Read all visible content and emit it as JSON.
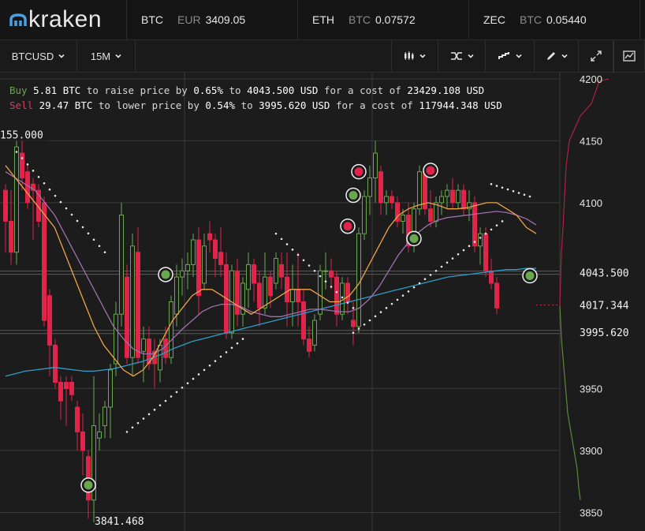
{
  "brand": {
    "name": "kraken"
  },
  "tickers": [
    {
      "symbol": "BTC",
      "quote": "EUR",
      "price": "3409.05"
    },
    {
      "symbol": "ETH",
      "quote": "BTC",
      "price": "0.07572"
    },
    {
      "symbol": "ZEC",
      "quote": "BTC",
      "price": "0.05440"
    }
  ],
  "toolbar": {
    "pair": "BTCUSD",
    "interval": "15M",
    "icons": [
      "candlestick-icon",
      "indicators-icon",
      "step-line-icon",
      "pencil-icon",
      "expand-icon",
      "screenshot-icon"
    ]
  },
  "trade_messages": {
    "buy": {
      "label": "Buy",
      "amount": "5.81 BTC",
      "action": "to raise price by",
      "pct": "0.65%",
      "to": "to",
      "target": "4043.500 USD",
      "cost_text": "for a cost of",
      "cost": "23429.108 USD"
    },
    "sell": {
      "label": "Sell",
      "amount": "29.47 BTC",
      "action": "to lower price by",
      "pct": "0.54%",
      "to": "to",
      "target": "3995.620 USD",
      "cost_text": "for a cost of",
      "cost": "117944.348 USD"
    }
  },
  "colors": {
    "up": "#6aa84f",
    "down": "#e0244a",
    "ema_fast": "#f0a44a",
    "ema_slow": "#a070b0",
    "ema_long": "#2e9ec8",
    "psar": "#e8e8e8",
    "depth_bid": "#5c8a3c",
    "depth_ask": "#b02040"
  },
  "chart_data": {
    "type": "candlestick",
    "pair": "BTCUSD",
    "interval": "15M",
    "ylim": [
      3835,
      4205
    ],
    "y_ticks": [
      4200,
      4150,
      4100,
      3950,
      3900,
      3850
    ],
    "price_labels": [
      {
        "label": "4043.500",
        "value": 4043.5,
        "style": "line"
      },
      {
        "label": "4017.344",
        "value": 4017.344,
        "style": "dashed"
      },
      {
        "label": "3995.620",
        "value": 3995.62,
        "style": "line"
      }
    ],
    "annotations": [
      {
        "label": "155.000",
        "value": 4155
      },
      {
        "label": "3841.468",
        "value": 3841.468
      }
    ],
    "candles": [
      [
        4110,
        4115,
        4060,
        4085
      ],
      [
        4085,
        4110,
        4050,
        4060
      ],
      [
        4060,
        4150,
        4050,
        4145
      ],
      [
        4140,
        4150,
        4110,
        4120
      ],
      [
        4125,
        4130,
        4095,
        4100
      ],
      [
        4115,
        4120,
        4070,
        4110
      ],
      [
        4110,
        4115,
        4080,
        4085
      ],
      [
        4100,
        4105,
        4000,
        4005
      ],
      [
        4025,
        4030,
        3960,
        3985
      ],
      [
        3985,
        3990,
        3950,
        3955
      ],
      [
        3955,
        3960,
        3925,
        3940
      ],
      [
        3955,
        3960,
        3920,
        3950
      ],
      [
        3955,
        3960,
        3940,
        3945
      ],
      [
        3935,
        3940,
        3900,
        3915
      ],
      [
        3915,
        3930,
        3880,
        3900
      ],
      [
        3895,
        3900,
        3845,
        3860
      ],
      [
        3860,
        3960,
        3842,
        3920
      ],
      [
        3910,
        3930,
        3900,
        3915
      ],
      [
        3920,
        3940,
        3910,
        3935
      ],
      [
        3935,
        3970,
        3910,
        3965
      ],
      [
        3970,
        4020,
        3960,
        4010
      ],
      [
        4010,
        4100,
        4000,
        4090
      ],
      [
        4040,
        4050,
        3970,
        3975
      ],
      [
        3975,
        4075,
        3960,
        4065
      ],
      [
        4060,
        4080,
        3970,
        3975
      ],
      [
        3980,
        4000,
        3955,
        3990
      ],
      [
        3990,
        4000,
        3965,
        3970
      ],
      [
        3980,
        3990,
        3950,
        3970
      ],
      [
        3965,
        3990,
        3955,
        3985
      ],
      [
        3990,
        4000,
        3970,
        3975
      ],
      [
        3975,
        4025,
        3970,
        4020
      ],
      [
        4010,
        4050,
        4000,
        4040
      ],
      [
        4040,
        4055,
        4025,
        4045
      ],
      [
        4045,
        4060,
        4030,
        4050
      ],
      [
        4050,
        4075,
        4040,
        4070
      ],
      [
        4070,
        4080,
        4010,
        4025
      ],
      [
        4035,
        4075,
        4030,
        4065
      ],
      [
        4075,
        4085,
        4060,
        4070
      ],
      [
        4070,
        4075,
        4040,
        4055
      ],
      [
        4060,
        4080,
        4040,
        4050
      ],
      [
        4050,
        4060,
        3990,
        3995
      ],
      [
        3995,
        4050,
        3990,
        4045
      ],
      [
        4045,
        4055,
        4000,
        4010
      ],
      [
        4010,
        4040,
        4000,
        4035
      ],
      [
        4030,
        4060,
        4015,
        4050
      ],
      [
        4050,
        4055,
        4020,
        4035
      ],
      [
        4035,
        4045,
        4000,
        4015
      ],
      [
        4015,
        4060,
        4010,
        4040
      ],
      [
        4040,
        4045,
        4015,
        4025
      ],
      [
        4035,
        4060,
        4030,
        4055
      ],
      [
        4050,
        4060,
        4030,
        4040
      ],
      [
        4040,
        4060,
        4000,
        4020
      ],
      [
        4020,
        4050,
        4000,
        4030
      ],
      [
        4030,
        4060,
        4000,
        4020
      ],
      [
        4020,
        4030,
        3985,
        3990
      ],
      [
        3990,
        4000,
        3975,
        3980
      ],
      [
        3985,
        4010,
        3980,
        4005
      ],
      [
        4010,
        4050,
        4005,
        4045
      ],
      [
        4045,
        4060,
        4030,
        4045
      ],
      [
        4045,
        4055,
        4030,
        4040
      ],
      [
        4040,
        4045,
        4000,
        4010
      ],
      [
        4010,
        4040,
        4005,
        4035
      ],
      [
        4035,
        4040,
        4010,
        4020
      ],
      [
        4005,
        4020,
        3985,
        4000
      ],
      [
        4000,
        4080,
        3995,
        4075
      ],
      [
        4075,
        4110,
        4070,
        4105
      ],
      [
        4105,
        4130,
        4090,
        4120
      ],
      [
        4120,
        4150,
        4100,
        4140
      ],
      [
        4125,
        4130,
        4090,
        4100
      ],
      [
        4100,
        4110,
        4090,
        4105
      ],
      [
        4105,
        4110,
        4095,
        4100
      ],
      [
        4100,
        4105,
        4080,
        4085
      ],
      [
        4085,
        4095,
        4075,
        4090
      ],
      [
        4090,
        4100,
        4060,
        4065
      ],
      [
        4070,
        4100,
        4060,
        4095
      ],
      [
        4095,
        4130,
        4090,
        4125
      ],
      [
        4125,
        4130,
        4090,
        4095
      ],
      [
        4095,
        4110,
        4080,
        4085
      ],
      [
        4085,
        4105,
        4080,
        4100
      ],
      [
        4100,
        4110,
        4090,
        4105
      ],
      [
        4105,
        4115,
        4095,
        4110
      ],
      [
        4110,
        4120,
        4095,
        4100
      ],
      [
        4100,
        4115,
        4095,
        4110
      ],
      [
        4110,
        4115,
        4090,
        4095
      ],
      [
        4095,
        4110,
        4085,
        4100
      ],
      [
        4100,
        4105,
        4060,
        4065
      ],
      [
        4065,
        4080,
        4050,
        4075
      ],
      [
        4075,
        4080,
        4040,
        4045
      ],
      [
        4045,
        4055,
        4030,
        4035
      ],
      [
        4035,
        4040,
        4010,
        4015
      ]
    ],
    "ema_fast": [
      4130,
      4120,
      4110,
      4100,
      4090,
      4080,
      4060,
      4040,
      4020,
      4000,
      3985,
      3975,
      3965,
      3960,
      3965,
      3975,
      3990,
      4005,
      4015,
      4025,
      4030,
      4030,
      4025,
      4020,
      4015,
      4010,
      4015,
      4020,
      4025,
      4030,
      4030,
      4030,
      4025,
      4020,
      4020,
      4025,
      4035,
      4050,
      4065,
      4080,
      4090,
      4095,
      4098,
      4100,
      4098,
      4095,
      4095,
      4096,
      4098,
      4100,
      4100,
      4095,
      4090,
      4080,
      4075
    ],
    "ema_slow": [
      4125,
      4120,
      4115,
      4110,
      4100,
      4090,
      4075,
      4060,
      4045,
      4030,
      4015,
      4000,
      3990,
      3982,
      3978,
      3978,
      3982,
      3990,
      3998,
      4005,
      4012,
      4016,
      4018,
      4018,
      4016,
      4012,
      4010,
      4008,
      4008,
      4010,
      4012,
      4014,
      4014,
      4013,
      4012,
      4012,
      4015,
      4022,
      4032,
      4045,
      4058,
      4068,
      4076,
      4082,
      4086,
      4088,
      4089,
      4090,
      4091,
      4092,
      4093,
      4092,
      4090,
      4087,
      4082
    ],
    "ema_long": [
      3960,
      3962,
      3964,
      3965,
      3966,
      3967,
      3966,
      3965,
      3964,
      3964,
      3965,
      3966,
      3968,
      3970,
      3972,
      3975,
      3978,
      3982,
      3985,
      3988,
      3990,
      3992,
      3994,
      3996,
      3998,
      4000,
      4002,
      4004,
      4006,
      4008,
      4010,
      4012,
      4014,
      4016,
      4018,
      4020,
      4022,
      4024,
      4026,
      4028,
      4030,
      4032,
      4034,
      4036,
      4038,
      4040,
      4041,
      4042,
      4043,
      4044,
      4045,
      4046,
      4046,
      4047,
      4047
    ],
    "psar_segments": [
      {
        "from": [
          2,
          4141
        ],
        "to": [
          18,
          4060
        ]
      },
      {
        "from": [
          22,
          3915
        ],
        "to": [
          43,
          3990
        ]
      },
      {
        "from": [
          49,
          4075
        ],
        "to": [
          63,
          4015
        ]
      },
      {
        "from": [
          63,
          3995
        ],
        "to": [
          90,
          4085
        ]
      },
      {
        "from": [
          88,
          4115
        ],
        "to": [
          95,
          4105
        ]
      }
    ],
    "signals": [
      {
        "i": 15,
        "price": 3872,
        "side": "buy"
      },
      {
        "i": 29,
        "price": 4042,
        "side": "buy"
      },
      {
        "i": 62,
        "price": 4081,
        "side": "sell"
      },
      {
        "i": 63,
        "price": 4106,
        "side": "buy"
      },
      {
        "i": 64,
        "price": 4125,
        "side": "sell"
      },
      {
        "i": 74,
        "price": 4071,
        "side": "buy"
      },
      {
        "i": 77,
        "price": 4126,
        "side": "sell"
      },
      {
        "i": 95,
        "price": 4041,
        "side": "buy"
      }
    ],
    "depth_bid": [
      [
        4017,
        0
      ],
      [
        3990,
        2
      ],
      [
        3975,
        4
      ],
      [
        3960,
        6
      ],
      [
        3945,
        8
      ],
      [
        3930,
        10
      ],
      [
        3915,
        14
      ],
      [
        3900,
        18
      ],
      [
        3885,
        22
      ],
      [
        3870,
        24
      ],
      [
        3860,
        26
      ]
    ],
    "depth_ask": [
      [
        4017,
        0
      ],
      [
        4060,
        2
      ],
      [
        4080,
        4
      ],
      [
        4130,
        8
      ],
      [
        4150,
        12
      ],
      [
        4170,
        26
      ],
      [
        4180,
        40
      ],
      [
        4198,
        50
      ],
      [
        4200,
        62
      ]
    ]
  }
}
